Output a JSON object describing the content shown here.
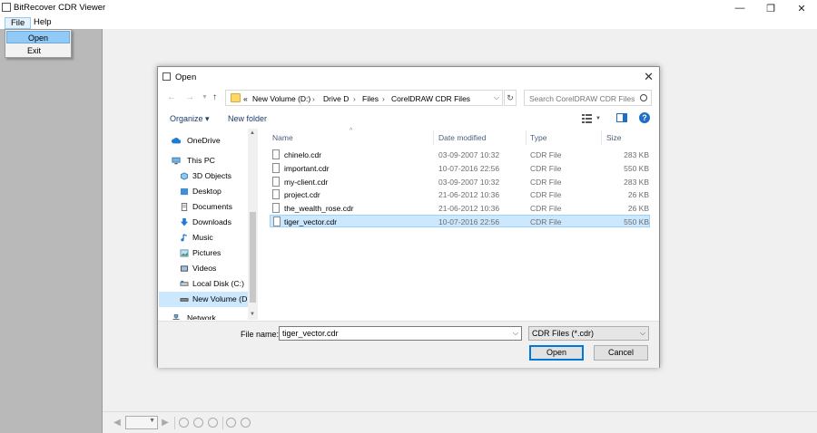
{
  "app": {
    "title": "BitRecover CDR Viewer",
    "controls": {
      "minimize": "—",
      "maximize": "❐",
      "close": "✕"
    }
  },
  "menubar": {
    "items": [
      {
        "label": "File"
      },
      {
        "label": "Help"
      }
    ],
    "file_menu": {
      "items": [
        {
          "label": "Open"
        },
        {
          "label": "Exit"
        }
      ]
    }
  },
  "dialog": {
    "title": "Open",
    "address": {
      "overflow": "«",
      "crumbs": [
        "New Volume (D:)",
        "Drive D",
        "Files",
        "CorelDRAW CDR Files"
      ],
      "separator": "›"
    },
    "search_placeholder": "Search CorelDRAW CDR Files",
    "toolbar": {
      "organize": "Organize ▾",
      "new_folder": "New folder"
    },
    "nav_tree": [
      {
        "label": "OneDrive",
        "icon": "cloud-icon"
      },
      {
        "label": "This PC",
        "icon": "computer-icon"
      },
      {
        "label": "3D Objects",
        "icon": "3d-objects-icon"
      },
      {
        "label": "Desktop",
        "icon": "desktop-icon"
      },
      {
        "label": "Documents",
        "icon": "documents-icon"
      },
      {
        "label": "Downloads",
        "icon": "download-icon"
      },
      {
        "label": "Music",
        "icon": "music-icon"
      },
      {
        "label": "Pictures",
        "icon": "pictures-icon"
      },
      {
        "label": "Videos",
        "icon": "videos-icon"
      },
      {
        "label": "Local Disk (C:)",
        "icon": "drive-icon"
      },
      {
        "label": "New Volume (D:)",
        "icon": "drive-icon"
      },
      {
        "label": "Network",
        "icon": "network-icon"
      }
    ],
    "columns": {
      "name": "Name",
      "date": "Date modified",
      "type": "Type",
      "size": "Size"
    },
    "files": [
      {
        "name": "chinelo.cdr",
        "date": "03-09-2007 10:32",
        "type": "CDR File",
        "size": "283 KB"
      },
      {
        "name": "important.cdr",
        "date": "10-07-2016 22:56",
        "type": "CDR File",
        "size": "550 KB"
      },
      {
        "name": "my-client.cdr",
        "date": "03-09-2007 10:32",
        "type": "CDR File",
        "size": "283 KB"
      },
      {
        "name": "project.cdr",
        "date": "21-06-2012 10:36",
        "type": "CDR File",
        "size": "26 KB"
      },
      {
        "name": "the_wealth_rose.cdr",
        "date": "21-06-2012 10:36",
        "type": "CDR File",
        "size": "26 KB"
      },
      {
        "name": "tiger_vector.cdr",
        "date": "10-07-2016 22:56",
        "type": "CDR File",
        "size": "550 KB"
      }
    ],
    "selected_file": "tiger_vector.cdr",
    "file_name_label": "File name:",
    "file_name_value": "tiger_vector.cdr",
    "filter_value": "CDR Files (*.cdr)",
    "open_label": "Open",
    "cancel_label": "Cancel",
    "colors": {
      "selection": "#cce8ff",
      "accent": "#0078d7"
    }
  }
}
